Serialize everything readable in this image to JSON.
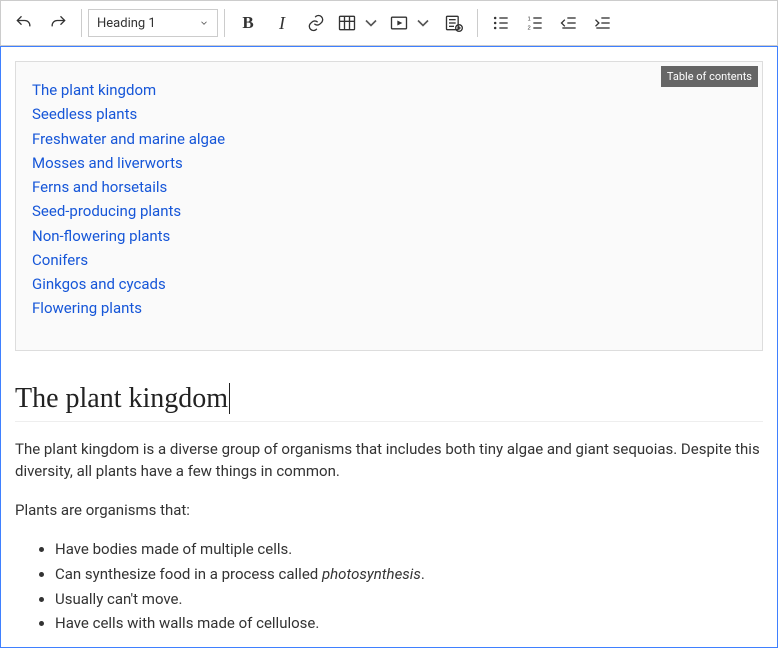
{
  "toolbar": {
    "heading_dropdown": "Heading 1"
  },
  "toc": {
    "badge": "Table of contents",
    "items": {
      "l1": "The plant kingdom",
      "l2a": "Seedless plants",
      "l3a": "Freshwater and marine algae",
      "l3b": "Mosses and liverworts",
      "l3c": "Ferns and horsetails",
      "l2b": "Seed-producing plants",
      "l3d": "Non-flowering plants",
      "l4a": "Conifers",
      "l4b": "Ginkgos and cycads",
      "l3e": "Flowering plants"
    }
  },
  "doc": {
    "h1": "The plant kingdom",
    "p1": "The plant kingdom is a diverse group of organisms that includes both tiny algae and giant sequoias. Despite this diversity, all plants have a few things in common.",
    "p2": "Plants are organisms that:",
    "li1": "Have bodies made of multiple cells.",
    "li2a": "Can synthesize food in a process called ",
    "li2b": "photosynthesis",
    "li2c": ".",
    "li3": "Usually can't move.",
    "li4": "Have cells with walls made of cellulose."
  }
}
